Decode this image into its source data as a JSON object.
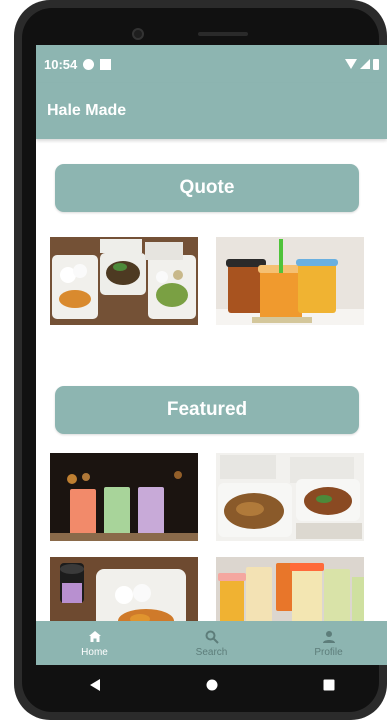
{
  "status_bar": {
    "time": "10:54"
  },
  "app_bar": {
    "title": "Hale Made"
  },
  "sections": {
    "quote_label": "Quote",
    "featured_label": "Featured"
  },
  "bottom_nav": [
    {
      "label": "Home"
    },
    {
      "label": "Search"
    },
    {
      "label": "Profile"
    }
  ],
  "colors": {
    "accent": "#8db5b1",
    "active_nav": "#ffffff",
    "inactive_nav": "#5d7d7a"
  }
}
